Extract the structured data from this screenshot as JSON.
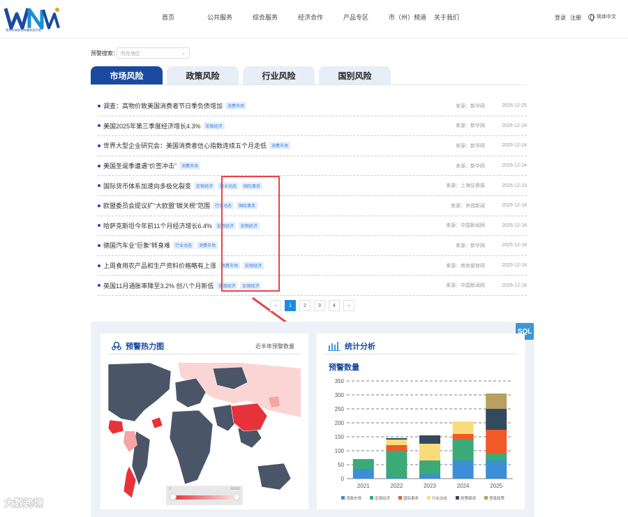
{
  "header": {
    "logo_text": "WN",
    "logo_sub": "贵州外经贸公共服务云平台",
    "nav": [
      "首页",
      "公共服务",
      "综合服务",
      "经济合作",
      "产品专区",
      "市（州）频道",
      "关于我们"
    ],
    "login": "登录",
    "register": "注册",
    "lang": "简体中文"
  },
  "search": {
    "label": "预警搜索：",
    "placeholder": "所在地区"
  },
  "tabs": [
    "市场风险",
    "政策风险",
    "行业风险",
    "国别风险"
  ],
  "news": [
    {
      "title": "调查：高物价致美国消费者节日季负债增加",
      "tags": [
        "消费市场"
      ],
      "source": "来源：新华网",
      "date": "2025-12-25"
    },
    {
      "title": "美国2025年第三季度经济增长4.3%",
      "tags": [
        "宏观经济"
      ],
      "source": "来源：新华网",
      "date": "2025-12-24"
    },
    {
      "title": "世界大型企业研究会：美国消费者信心指数连续五个月走低",
      "tags": [
        "消费市场"
      ],
      "source": "来源：新华网",
      "date": "2025-12-24"
    },
    {
      "title": "美国圣诞季遭遇“价签冲击”",
      "tags": [
        "消费市场"
      ],
      "source": "来源：新华网",
      "date": "2025-12-24"
    },
    {
      "title": "国际货币体系加速向多极化裂变",
      "tags": [
        "宏观经济",
        "行业动态",
        "国际事务"
      ],
      "source": "来源：上海证券报",
      "date": "2025-12-23"
    },
    {
      "title": "欧盟委员会提议扩“大欧盟”碳关税”范围",
      "tags": [
        "行业动态",
        "国际事务"
      ],
      "source": "来源：央视新闻",
      "date": "2025-12-18"
    },
    {
      "title": "哈萨克斯坦今年前11个月经济增长6.4%",
      "tags": [
        "宏观经济",
        "宏观经济"
      ],
      "source": "来源：中国新闻网",
      "date": "2025-12-18"
    },
    {
      "title": "德国汽车业“巨象”转身难",
      "tags": [
        "行业动态",
        "消费市场"
      ],
      "source": "来源：新华网",
      "date": "2025-12-18"
    },
    {
      "title": "上周食用农产品和生产资料价格略有上涨",
      "tags": [
        "消费市场",
        "宏观经济"
      ],
      "source": "来源：商务部官网",
      "date": "2025-12-18"
    },
    {
      "title": "英国11月通胀率降至3.2% 创八个月新低",
      "tags": [
        "宏观经济",
        "宏观经济"
      ],
      "source": "来源：中国新闻网",
      "date": "2025-12-18"
    }
  ],
  "pager": {
    "prev": "‹",
    "pages": [
      "1",
      "2",
      "3",
      "4"
    ],
    "next": "›",
    "active": "1"
  },
  "sql_badge": "SQL",
  "heatmap": {
    "title": "预警热力图",
    "subtitle": "近半年预警数量",
    "scale_min": "0",
    "scale_max": "46000"
  },
  "stats": {
    "title": "统计分析"
  },
  "watermark": "大数跨境",
  "colors": {
    "brand": "#1a4aa0",
    "accent": "#1e8be0",
    "highlight": "#e8434b"
  },
  "chart_data": {
    "type": "bar",
    "stacked": true,
    "title": "预警数量",
    "categories": [
      "2021",
      "2022",
      "2023",
      "2024",
      "2025"
    ],
    "ylim": [
      0,
      350
    ],
    "yticks": [
      0,
      50,
      100,
      150,
      200,
      250,
      300,
      350
    ],
    "series": [
      {
        "name": "消费市场",
        "color": "#3a8fd6",
        "values": [
          35,
          5,
          15,
          65,
          65
        ]
      },
      {
        "name": "宏观经济",
        "color": "#3aaa77",
        "values": [
          35,
          95,
          50,
          75,
          25
        ]
      },
      {
        "name": "国际事务",
        "color": "#f05a28",
        "values": [
          0,
          20,
          0,
          20,
          85
        ]
      },
      {
        "name": "行业动态",
        "color": "#f9dc7a",
        "values": [
          0,
          20,
          60,
          45,
          0
        ]
      },
      {
        "name": "政策解读",
        "color": "#34495e",
        "values": [
          0,
          5,
          30,
          0,
          75
        ]
      },
      {
        "name": "贸易政策",
        "color": "#b8a060",
        "values": [
          0,
          0,
          0,
          0,
          55
        ]
      }
    ],
    "legend_position": "bottom",
    "grid": true
  }
}
